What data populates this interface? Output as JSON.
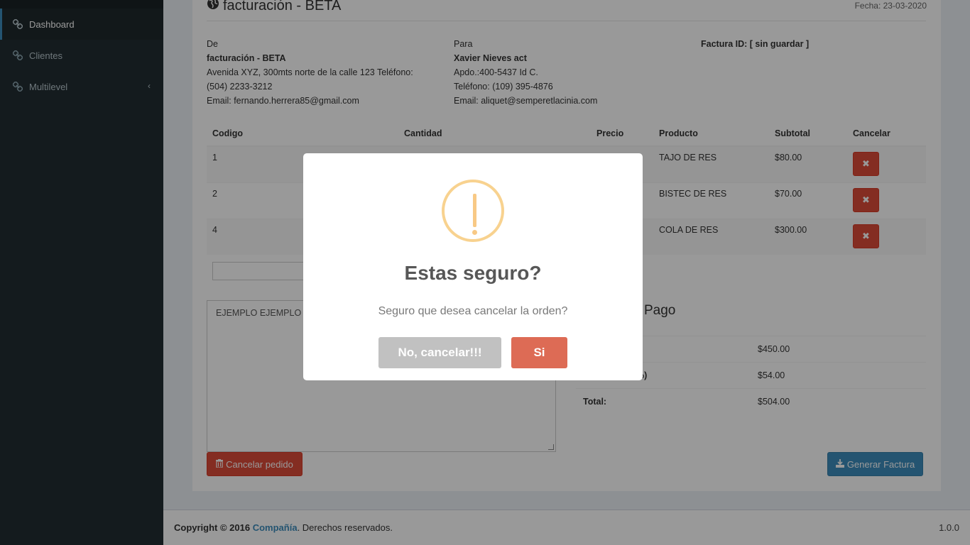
{
  "sidebar": {
    "items": [
      {
        "label": "Dashboard"
      },
      {
        "label": "Clientes"
      },
      {
        "label": "Multilevel"
      }
    ]
  },
  "header": {
    "title": "facturación - BETA",
    "fecha": "Fecha: 23-03-2020"
  },
  "from": {
    "heading": "De",
    "name": "facturación - BETA",
    "address": "Avenida XYZ, 300mts norte de la calle 123 Teléfono:",
    "phone": "(504) 2233-3212",
    "email": "Email: fernando.herrera85@gmail.com"
  },
  "to": {
    "heading": "Para",
    "name": "Xavier Nieves act",
    "address": "Apdo.:400-5437 Id C.",
    "phone": "Teléfono: (109) 395-4876",
    "email": "Email: aliquet@semperetlacinia.com"
  },
  "invoice": {
    "label": "Factura ID: [ sin guardar ]"
  },
  "table": {
    "headers": [
      "Codigo",
      "Cantidad",
      "Precio",
      "Producto",
      "Subtotal",
      "Cancelar"
    ],
    "rows": [
      {
        "codigo": "1",
        "producto": "TAJO DE RES",
        "subtotal": "$80.00"
      },
      {
        "codigo": "2",
        "producto": "BISTEC DE RES",
        "subtotal": "$70.00"
      },
      {
        "codigo": "4",
        "producto": "COLA DE RES",
        "subtotal": "$300.00"
      }
    ]
  },
  "notes": {
    "value": "EJEMPLO EJEMPLO"
  },
  "totals": {
    "title": "Pago",
    "rows": [
      {
        "label": "",
        "value": "$450.00"
      },
      {
        "label": "%)",
        "value": "$54.00"
      },
      {
        "label": "Total:",
        "value": "$504.00"
      }
    ]
  },
  "buttons": {
    "cancel": "Cancelar pedido",
    "generate": "Generar Factura"
  },
  "footer": {
    "copy": "Copyright © 2016 ",
    "company": "Compañía",
    "rest": ". Derechos reservados.",
    "version": "1.0.0"
  },
  "modal": {
    "title": "Estas seguro?",
    "text": "Seguro que desea cancelar la orden?",
    "no_label": "No, cancelar!!!",
    "yes_label": "Si"
  },
  "colors": {
    "danger": "#dd4b39",
    "primary": "#3c8dbc",
    "sidebar": "#222d32",
    "warning": "#f8d28f",
    "confirm": "#dd6b55"
  }
}
